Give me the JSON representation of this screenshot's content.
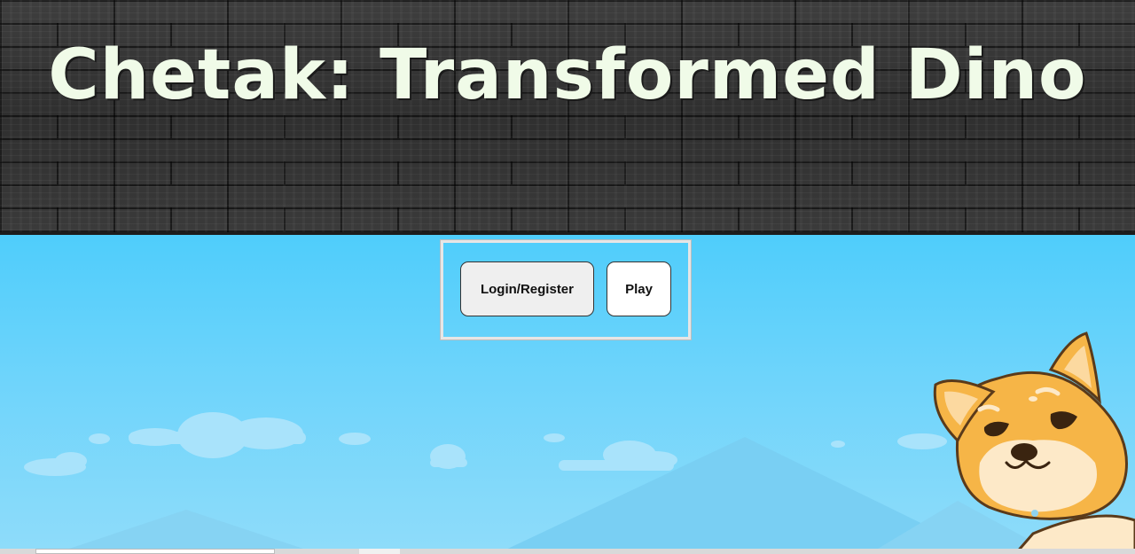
{
  "header": {
    "title": "Chetak: Transformed Dino"
  },
  "menu": {
    "login_label": "Login/Register",
    "play_label": "Play"
  },
  "colors": {
    "title_text": "#f0fbe8",
    "sky_top": "#4fcdfb",
    "sky_bottom": "#8fdcfa",
    "wall": "#2b2b2b",
    "login_bg": "#efefef",
    "play_bg": "#ffffff"
  },
  "mascot": {
    "icon": "shiba-dog-icon"
  }
}
